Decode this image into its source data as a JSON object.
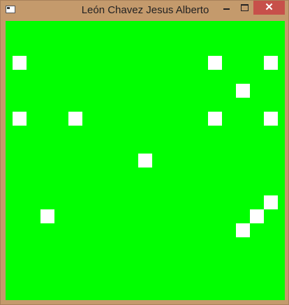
{
  "window": {
    "title": "León Chavez Jesus Alberto",
    "close_glyph": "✕"
  },
  "board": {
    "background": "#00ff00",
    "cell_color": "#ffffff",
    "columns": 20,
    "rows": 20,
    "cells": [
      {
        "col": 0,
        "row": 2
      },
      {
        "col": 14,
        "row": 2
      },
      {
        "col": 18,
        "row": 2
      },
      {
        "col": 16,
        "row": 4
      },
      {
        "col": 0,
        "row": 6
      },
      {
        "col": 4,
        "row": 6
      },
      {
        "col": 14,
        "row": 6
      },
      {
        "col": 18,
        "row": 6
      },
      {
        "col": 9,
        "row": 9
      },
      {
        "col": 18,
        "row": 12
      },
      {
        "col": 17,
        "row": 13
      },
      {
        "col": 2,
        "row": 13
      },
      {
        "col": 16,
        "row": 14
      }
    ]
  }
}
